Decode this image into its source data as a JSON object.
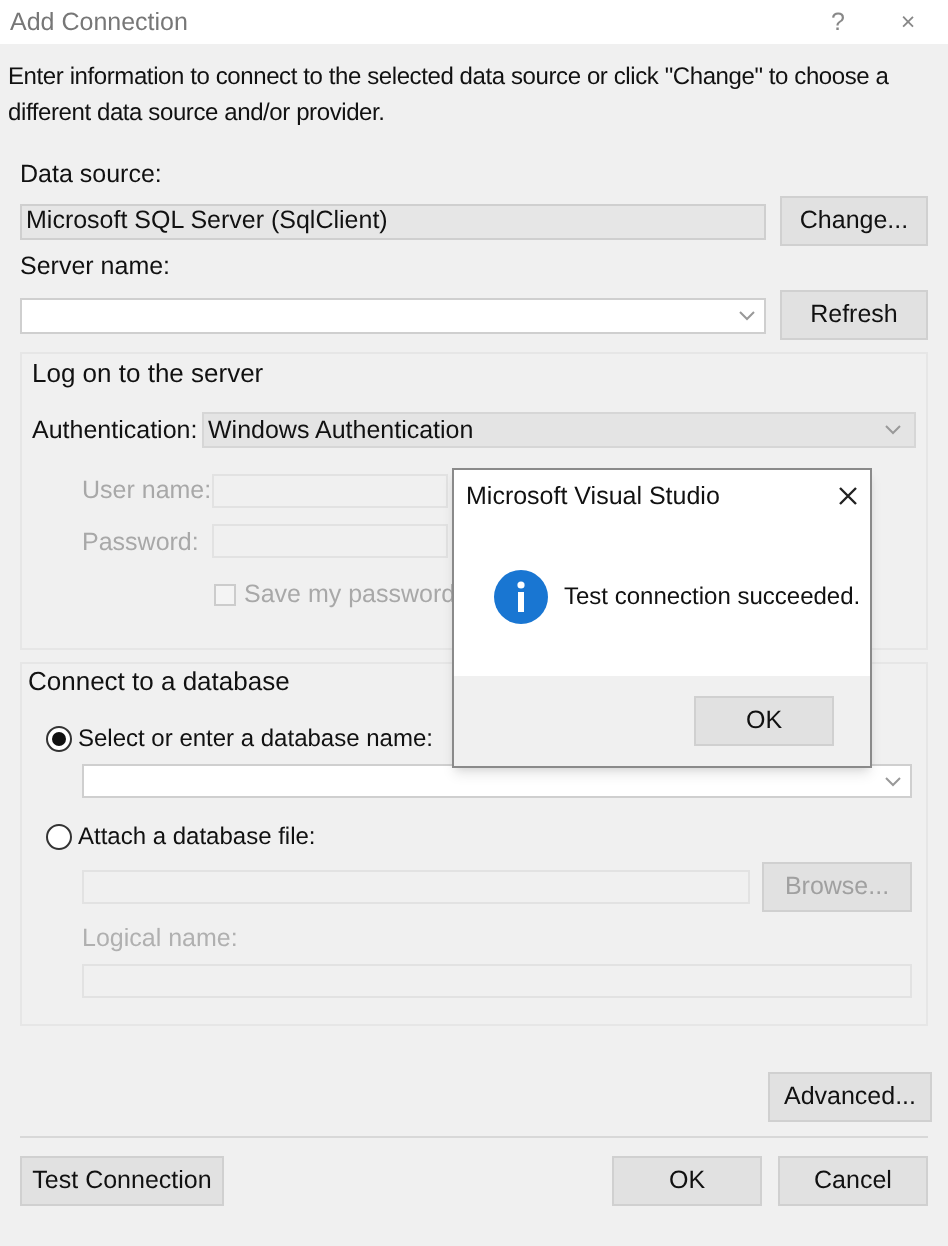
{
  "window": {
    "title": "Add Connection",
    "help": "?",
    "close": "×"
  },
  "description": "Enter information to connect to the selected data source or click \"Change\" to choose a different data source and/or provider.",
  "data_source": {
    "label": "Data source:",
    "value": "Microsoft SQL Server (SqlClient)",
    "button": "Change..."
  },
  "server_name": {
    "label": "Server name:",
    "button": "Refresh"
  },
  "logon": {
    "title": "Log on to the server",
    "auth_label": "Authentication:",
    "auth_value": "Windows Authentication",
    "user_label": "User name:",
    "password_label": "Password:",
    "save_password": {
      "label": "Save my password",
      "checked": false,
      "disabled": true
    }
  },
  "database": {
    "title": "Connect to a database",
    "options": [
      {
        "label": "Select or enter a database name:",
        "selected": true
      },
      {
        "label": "Attach a database file:",
        "selected": false
      }
    ],
    "browse": "Browse...",
    "logical_label": "Logical name:"
  },
  "advanced": "Advanced...",
  "buttons": {
    "test": "Test Connection",
    "ok": "OK",
    "cancel": "Cancel"
  },
  "message_box": {
    "title": "Microsoft Visual Studio",
    "message": "Test connection succeeded.",
    "ok": "OK"
  }
}
